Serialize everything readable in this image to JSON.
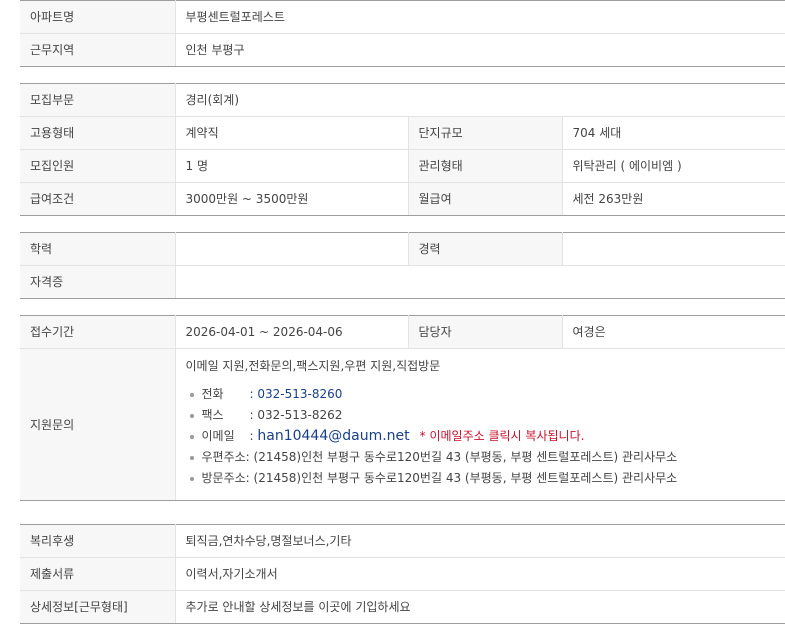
{
  "section1": {
    "apartment_label": "아파트명",
    "apartment_value": "부평센트럴포레스트",
    "region_label": "근무지역",
    "region_value": "인천  부평구"
  },
  "section2": {
    "dept_label": "모집부문",
    "dept_value": "경리(회계)",
    "employ_label": "고용형태",
    "employ_value": "계약직",
    "scale_label": "단지규모",
    "scale_value": "704 세대",
    "count_label": "모집인원",
    "count_value": "1 명",
    "manage_label": "관리형태",
    "manage_value": "위탁관리 ( 에이비엠 )",
    "salary_label": "급여조건",
    "salary_value": "3000만원 ~ 3500만원",
    "monthly_label": "월급여",
    "monthly_value": "세전 263만원"
  },
  "section3": {
    "edu_label": "학력",
    "edu_value": "",
    "career_label": "경력",
    "career_value": "",
    "cert_label": "자격증",
    "cert_value": ""
  },
  "section4": {
    "period_label": "접수기간",
    "period_value": "2026-04-01 ~ 2026-04-06",
    "manager_label": "담당자",
    "manager_value": "여경은",
    "inquiry_label": "지원문의",
    "inquiry_methods": "이메일 지원,전화문의,팩스지원,우편 지원,직접방문",
    "phone_key": "전화",
    "phone_value": ": 032-513-8260",
    "fax_key": "팩스",
    "fax_value": ": 032-513-8262",
    "email_key": "이메일",
    "email_sep": ":",
    "email_value": "han10444@daum.net",
    "email_note": "* 이메일주소 클릭시 복사됩니다.",
    "post_key": "우편주소",
    "post_value": ": (21458)인천 부평구 동수로120번길 43 (부평동, 부평 센트럴포레스트) 관리사무소",
    "visit_key": "방문주소",
    "visit_value": ": (21458)인천 부평구 동수로120번길 43 (부평동, 부평 센트럴포레스트) 관리사무소"
  },
  "section5": {
    "welfare_label": "복리후생",
    "welfare_value": "퇴직금,연차수당,명절보너스,기타",
    "docs_label": "제출서류",
    "docs_value": "이력서,자기소개서",
    "detail_label": "상세정보[근무형태]",
    "detail_value": "추가로 안내할 상세정보를 이곳에 기입하세요"
  },
  "colors": {
    "label_bg": "#f7f7f7",
    "border": "#e3e3e3",
    "top_border": "#9e9e9e",
    "link": "#1a3f8a",
    "note": "#c8102e"
  }
}
